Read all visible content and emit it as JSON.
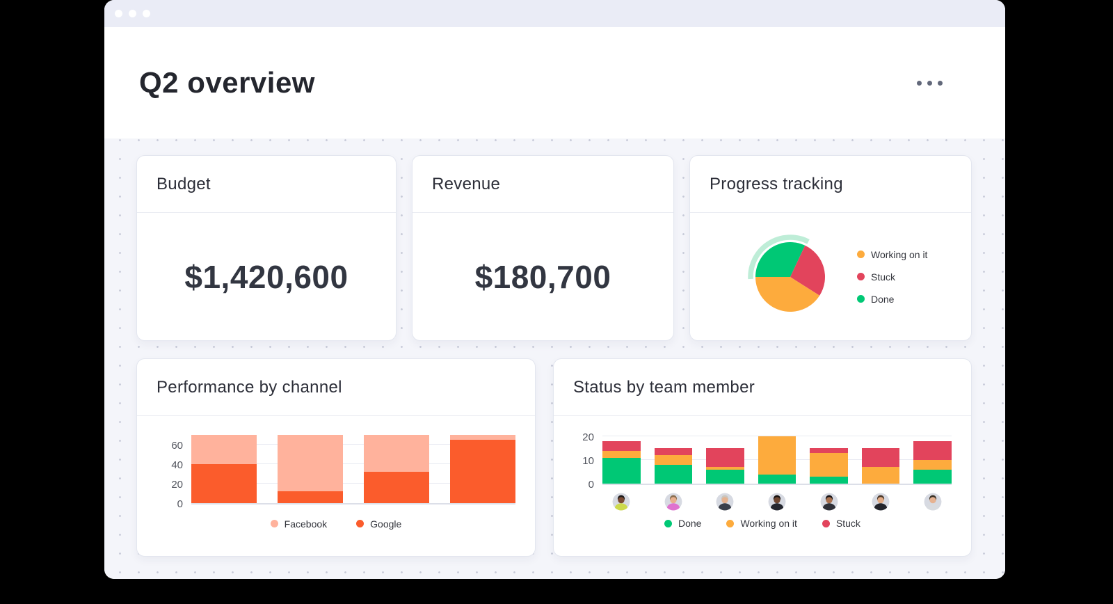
{
  "window": {
    "titlebar": {
      "dot_count": 3
    },
    "header": {
      "title": "Q2 overview",
      "menu_icon": "ellipsis-horizontal"
    }
  },
  "colors": {
    "accent_green": "#00c875",
    "accent_orange": "#fdab3d",
    "accent_red": "#e2445c",
    "google_orange": "#fb5c2c",
    "facebook_salmon": "#ffb29c",
    "highlight_mint": "#aee8cd",
    "text_dark": "#24262e",
    "canvas_bg": "#f4f5fa"
  },
  "cards": {
    "budget": {
      "title": "Budget",
      "value": "$1,420,600"
    },
    "revenue": {
      "title": "Revenue",
      "value": "$180,700"
    },
    "progress": {
      "title": "Progress tracking"
    },
    "performance": {
      "title": "Performance by channel"
    },
    "status": {
      "title": "Status by team member"
    }
  },
  "chart_data": [
    {
      "id": "progress-pie",
      "type": "pie",
      "title": "Progress tracking",
      "slices": [
        {
          "label": "Working on it",
          "value": 41,
          "color": "#fdab3d"
        },
        {
          "label": "Stuck",
          "value": 27,
          "color": "#e2445c"
        },
        {
          "label": "Done",
          "value": 32,
          "color": "#00c875"
        }
      ],
      "start_angle_deg": 270,
      "render_order": [
        2,
        1,
        0
      ],
      "highlight": {
        "slice": "Done",
        "color": "#aee8cd"
      },
      "legend_position": "right",
      "legend": [
        {
          "label": "Working on it",
          "color": "#fdab3d"
        },
        {
          "label": "Stuck",
          "color": "#e2445c"
        },
        {
          "label": "Done",
          "color": "#00c875"
        }
      ]
    },
    {
      "id": "performance-bars",
      "type": "bar",
      "stacked": true,
      "title": "Performance by channel",
      "categories": [
        "bar-1",
        "bar-2",
        "bar-3",
        "bar-4"
      ],
      "series": [
        {
          "name": "Google",
          "color": "#fb5c2c",
          "values": [
            40,
            12,
            32,
            65
          ]
        },
        {
          "name": "Facebook",
          "color": "#ffb29c",
          "values": [
            30,
            58,
            38,
            5
          ]
        }
      ],
      "yticks": [
        0,
        20,
        40,
        60
      ],
      "ylim": [
        0,
        72
      ],
      "grid": true,
      "xlabel": "",
      "ylabel": "",
      "legend_position": "bottom",
      "legend": [
        {
          "label": "Facebook",
          "color": "#ffb29c"
        },
        {
          "label": "Google",
          "color": "#fb5c2c"
        }
      ]
    },
    {
      "id": "status-bars",
      "type": "bar",
      "stacked": true,
      "title": "Status by team member",
      "categories": [
        "member-1",
        "member-2",
        "member-3",
        "member-4",
        "member-5",
        "member-6",
        "member-7"
      ],
      "series": [
        {
          "name": "Done",
          "color": "#00c875",
          "values": [
            11,
            8,
            6,
            4,
            3,
            0,
            6
          ]
        },
        {
          "name": "Working on it",
          "color": "#fdab3d",
          "values": [
            3,
            4,
            1,
            16,
            10,
            7,
            4
          ]
        },
        {
          "name": "Stuck",
          "color": "#e2445c",
          "values": [
            4,
            3,
            8,
            0,
            2,
            8,
            8
          ]
        }
      ],
      "yticks": [
        0,
        10,
        20
      ],
      "ylim": [
        0,
        21.5
      ],
      "grid": true,
      "xlabel": "",
      "ylabel": "",
      "legend_position": "bottom",
      "legend": [
        {
          "label": "Done",
          "color": "#00c875"
        },
        {
          "label": "Working on it",
          "color": "#fdab3d"
        },
        {
          "label": "Stuck",
          "color": "#e2445c"
        }
      ],
      "avatars": [
        {
          "skin": "#7a4a32",
          "hair": "#1d1b1c",
          "shirt": "#cdd94c"
        },
        {
          "skin": "#e8b08e",
          "hair": "#8a6f52",
          "shirt": "#df72cf"
        },
        {
          "skin": "#e5b28f",
          "hair": "#c9c5bd",
          "shirt": "#3a3f4a"
        },
        {
          "skin": "#6e4630",
          "hair": "#181411",
          "shirt": "#23262e"
        },
        {
          "skin": "#a9704e",
          "hair": "#171417",
          "shirt": "#2e3038"
        },
        {
          "skin": "#e3ac86",
          "hair": "#4d3b2c",
          "shirt": "#23252c"
        },
        {
          "skin": "#e6b291",
          "hair": "#3c3328",
          "shirt": "#d8dbe0"
        }
      ]
    }
  ]
}
